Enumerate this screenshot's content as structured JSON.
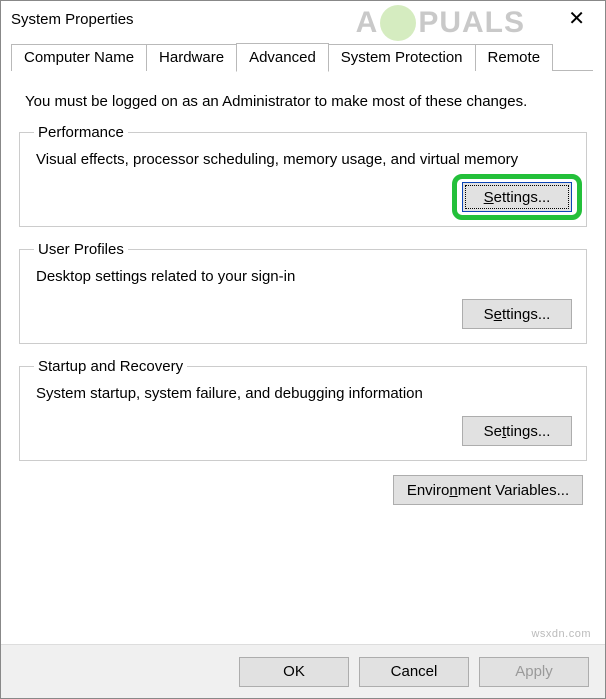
{
  "window": {
    "title": "System Properties"
  },
  "tabs": {
    "computer_name": "Computer Name",
    "hardware": "Hardware",
    "advanced": "Advanced",
    "system_protection": "System Protection",
    "remote": "Remote"
  },
  "intro": "You must be logged on as an Administrator to make most of these changes.",
  "groups": {
    "performance": {
      "legend": "Performance",
      "desc": "Visual effects, processor scheduling, memory usage, and virtual memory",
      "button": "Settings..."
    },
    "user_profiles": {
      "legend": "User Profiles",
      "desc": "Desktop settings related to your sign-in",
      "button": "Settings..."
    },
    "startup_recovery": {
      "legend": "Startup and Recovery",
      "desc": "System startup, system failure, and debugging information",
      "button": "Settings..."
    }
  },
  "env_vars_button": "Environment Variables...",
  "footer": {
    "ok": "OK",
    "cancel": "Cancel",
    "apply": "Apply"
  },
  "watermark": {
    "left": "A",
    "right": "PUALS"
  },
  "wsxdn": "wsxdn.com"
}
